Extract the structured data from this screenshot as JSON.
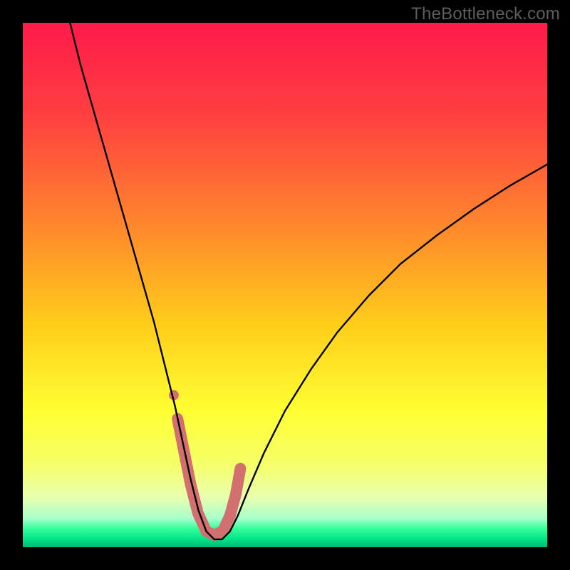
{
  "watermark": "TheBottleneck.com",
  "chart_data": {
    "type": "line",
    "title": "",
    "xlabel": "",
    "ylabel": "",
    "xlim": [
      0,
      100
    ],
    "ylim": [
      0,
      100
    ],
    "grid": false,
    "gradient_stops": [
      {
        "offset": 0,
        "color": "#ff1a4b"
      },
      {
        "offset": 0.18,
        "color": "#ff4040"
      },
      {
        "offset": 0.4,
        "color": "#ff8c2b"
      },
      {
        "offset": 0.58,
        "color": "#ffcf1a"
      },
      {
        "offset": 0.74,
        "color": "#ffff33"
      },
      {
        "offset": 0.84,
        "color": "#f6ff66"
      },
      {
        "offset": 0.905,
        "color": "#e8ffb0"
      },
      {
        "offset": 0.945,
        "color": "#a8ffcc"
      },
      {
        "offset": 0.965,
        "color": "#33ff99"
      },
      {
        "offset": 0.985,
        "color": "#00e288"
      },
      {
        "offset": 1.0,
        "color": "#00b877"
      }
    ],
    "series": [
      {
        "name": "bottleneck-curve",
        "x": [
          9,
          11,
          13,
          15,
          17,
          19,
          21,
          23,
          25,
          27,
          29,
          30.5,
          32,
          33.5,
          35,
          36.5,
          38,
          39.5,
          41,
          43,
          46,
          50,
          55,
          60,
          66,
          72,
          79,
          86,
          93,
          100
        ],
        "y": [
          100,
          92,
          85,
          78,
          71,
          64,
          57,
          50,
          43,
          35,
          27,
          20,
          13,
          7,
          3,
          1.5,
          1.5,
          3,
          6,
          11,
          18,
          26,
          34,
          41,
          48,
          54,
          59.5,
          64.5,
          69,
          73
        ],
        "color": "#000000",
        "width": 2.4
      }
    ],
    "highlight_segment": {
      "name": "bottom-u-highlight",
      "color": "#d1706e",
      "width": 16,
      "x": [
        29.5,
        30.7,
        32,
        33.4,
        35,
        36.6,
        38.2,
        39.5,
        40.6,
        41.5
      ],
      "y": [
        24.5,
        18.5,
        12,
        6.5,
        3,
        2.3,
        3.2,
        6,
        10,
        15
      ]
    },
    "highlight_dot": {
      "name": "marker-dot",
      "color": "#d1706e",
      "x": 28.8,
      "y": 29,
      "r": 7
    }
  }
}
